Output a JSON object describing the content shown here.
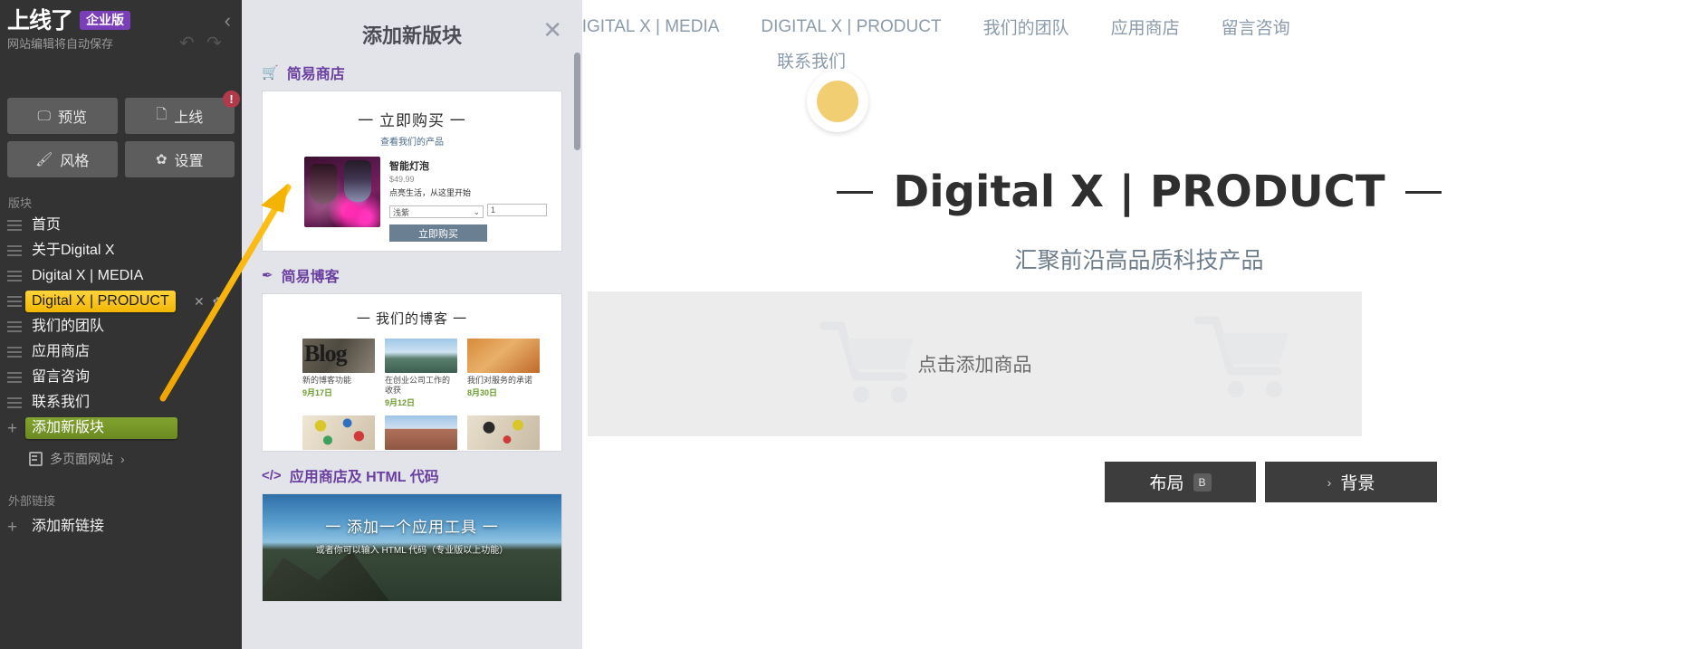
{
  "sidebar": {
    "logo": "上线了",
    "badge": "企业版",
    "autosave": "网站编辑将自动保存",
    "undo_icon": "undo-icon",
    "redo_icon": "redo-icon",
    "collapse_icon": "collapse-left-icon",
    "buttons": [
      {
        "label": "预览",
        "icon": "monitor-icon"
      },
      {
        "label": "上线",
        "icon": "file-icon",
        "alert": "!"
      },
      {
        "label": "风格",
        "icon": "brush-icon"
      },
      {
        "label": "设置",
        "icon": "gear-icon"
      }
    ],
    "section_label": "版块",
    "items": [
      {
        "label": "首页",
        "state": "normal"
      },
      {
        "label": "关于Digital X",
        "state": "normal"
      },
      {
        "label": "Digital X | MEDIA",
        "state": "normal"
      },
      {
        "label": "Digital X | PRODUCT",
        "state": "active"
      },
      {
        "label": "我们的团队",
        "state": "normal"
      },
      {
        "label": "应用商店",
        "state": "normal"
      },
      {
        "label": "留言咨询",
        "state": "normal"
      },
      {
        "label": "联系我们",
        "state": "normal"
      },
      {
        "label": "添加新版块",
        "state": "add"
      }
    ],
    "row_icons": {
      "close": "✕",
      "gear": "✿"
    },
    "multipage": "多页面网站",
    "multipage_chevron": "›",
    "external_label": "外部链接",
    "add_link": "添加新链接",
    "colors": {
      "bg": "#333333",
      "active": "#f2b705",
      "add": "#6b8a22",
      "badge": "#7a3fb8"
    }
  },
  "panel": {
    "title": "添加新版块",
    "close_icon": "close-icon",
    "groups": [
      {
        "icon": "cart-icon",
        "heading": "简易商店",
        "card": {
          "title": "一 立即购买 一",
          "subtitle": "查看我们的产品",
          "product_name": "智能灯泡",
          "price": "$49.99",
          "desc": "点亮生活，从这里开始",
          "select_value": "浅紫",
          "select_caret": "⌄",
          "qty_value": "1",
          "buy_label": "立即购买"
        }
      },
      {
        "icon": "pen-icon",
        "heading": "简易博客",
        "card": {
          "title": "一 我们的博客 一",
          "posts": [
            {
              "title": "新的博客功能",
              "date": "9月17日"
            },
            {
              "title": "在创业公司工作的收获",
              "date": "9月12日"
            },
            {
              "title": "我们对服务的承诺",
              "date": "8月30日"
            }
          ]
        }
      },
      {
        "icon": "code-icon",
        "icon_text": "</>",
        "heading": "应用商店及 HTML 代码",
        "card": {
          "title": "一 添加一个应用工具 一",
          "subtitle": "或者你可以输入 HTML 代码（专业版以上功能）"
        }
      }
    ]
  },
  "preview": {
    "nav": [
      {
        "label": "DIGITAL X | MEDIA"
      },
      {
        "label": "DIGITAL X | PRODUCT"
      },
      {
        "label": "我们的团队"
      },
      {
        "label": "应用商店"
      },
      {
        "label": "留言咨询"
      }
    ],
    "nav_second_row": "联系我们",
    "heading": "Digital X | PRODUCT",
    "subheading": "汇聚前沿高品质科技产品",
    "empty_text": "点击添加商品",
    "cart_icon": "shopping-cart-icon",
    "bottom_buttons": [
      {
        "label": "布局",
        "kbd": "B",
        "icon": ""
      },
      {
        "label": "背景",
        "kbd": "",
        "icon": "›"
      }
    ],
    "accent": "#f2ce72"
  }
}
